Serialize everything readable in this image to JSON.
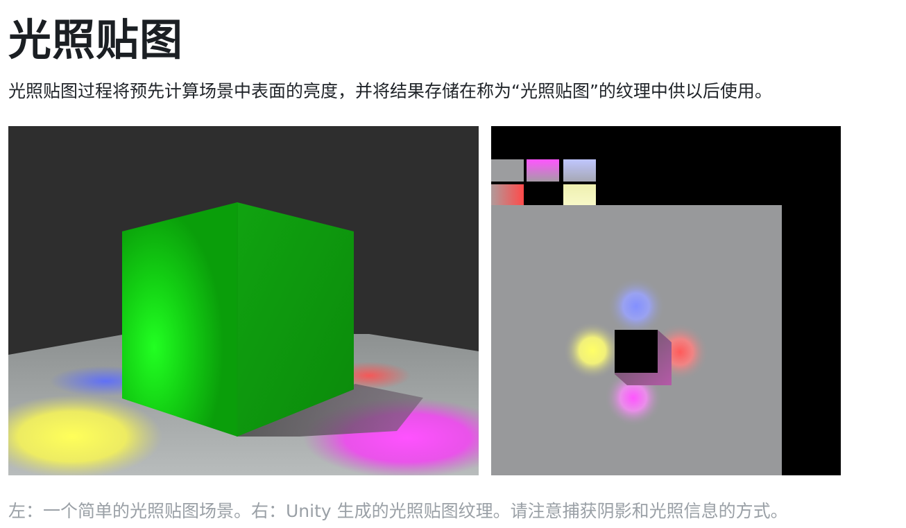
{
  "article": {
    "title": "光照贴图",
    "intro": "光照贴图过程将预先计算场景中表面的亮度，并将结果存储在称为“光照贴图”的纹理中供以后使用。",
    "caption": "左：一个简单的光照贴图场景。右：Unity 生成的光照贴图纹理。请注意捕获阴影和光照信息的方式。"
  },
  "figure": {
    "left_image": {
      "subject": "green-cube-scene",
      "colors": {
        "background": "#2e2e2e",
        "floor": "#a9adad",
        "cube": "#1fbf1f",
        "yellow_light": "#ffff66",
        "magenta_light": "#ff4dff",
        "blue_light": "#5b6bff",
        "red_light": "#ff4d4d"
      }
    },
    "right_image": {
      "subject": "lightmap-texture",
      "colors": {
        "background": "#000000",
        "atlas": "#98999b",
        "yellow_light": "#ffff66",
        "magenta_light": "#ff4dff",
        "blue_light": "#7f8cff",
        "red_light": "#ff4d4d"
      }
    }
  }
}
